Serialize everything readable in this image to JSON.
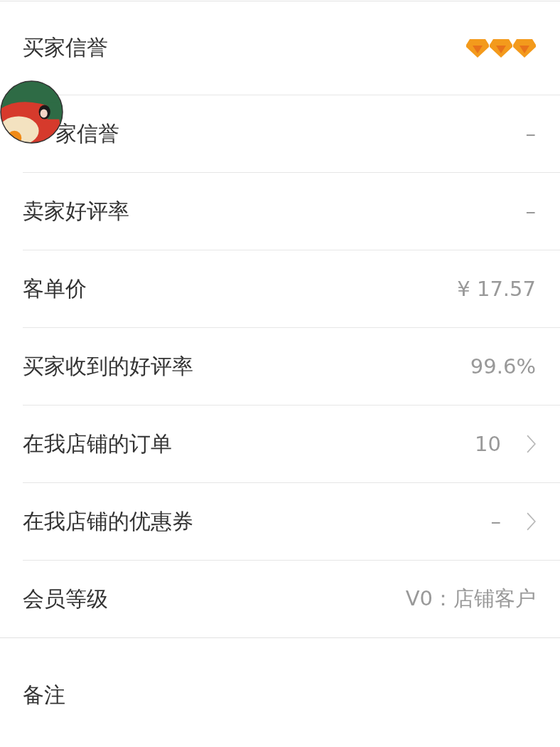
{
  "sections": [
    {
      "rows": [
        {
          "kind": "stars",
          "label": "买家信誉",
          "stars": 3
        },
        {
          "kind": "text",
          "label": "家信誉",
          "value": "–",
          "avatar_over_label": true
        },
        {
          "kind": "text",
          "label": "卖家好评率",
          "value": "–"
        },
        {
          "kind": "text",
          "label": "客单价",
          "value": "¥ 17.57"
        },
        {
          "kind": "text",
          "label": "买家收到的好评率",
          "value": "99.6%"
        },
        {
          "kind": "link",
          "label": "在我店铺的订单",
          "value": "10"
        },
        {
          "kind": "link",
          "label": "在我店铺的优惠券",
          "value": "–"
        },
        {
          "kind": "text",
          "label": "会员等级",
          "value": "V0：店铺客户"
        }
      ]
    },
    {
      "rows": [
        {
          "kind": "text",
          "label": "备注"
        }
      ]
    }
  ]
}
